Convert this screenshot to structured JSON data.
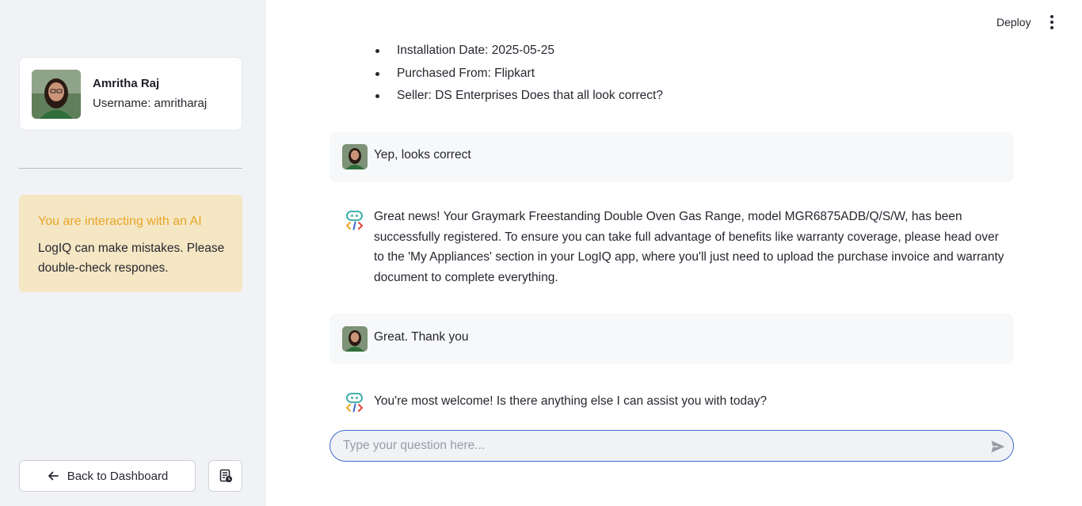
{
  "sidebar": {
    "profile": {
      "name": "Amritha Raj",
      "username": "Username: amritharaj"
    },
    "notice": {
      "title": "You are interacting with an AI",
      "body": "LogIQ can make mistakes. Please double-check respones."
    },
    "back_button_label": "Back to Dashboard"
  },
  "topbar": {
    "deploy_label": "Deploy"
  },
  "chat": {
    "bullets": [
      "Installation Date: 2025-05-25",
      "Purchased From: Flipkart",
      "Seller: DS Enterprises Does that all look correct?"
    ],
    "messages": [
      {
        "role": "user",
        "text": "Yep, looks correct"
      },
      {
        "role": "assistant",
        "text": "Great news! Your Graymark Freestanding Double Oven Gas Range, model MGR6875ADB/Q/S/W, has been successfully registered. To ensure you can take full advantage of benefits like warranty coverage, please head over to the 'My Appliances' section in your LogIQ app, where you'll just need to upload the purchase invoice and warranty document to complete everything."
      },
      {
        "role": "user",
        "text": "Great. Thank you"
      },
      {
        "role": "assistant",
        "text": "You're most welcome! Is there anything else I can assist you with today?"
      }
    ],
    "input": {
      "placeholder": "Type your question here...",
      "value": ""
    }
  },
  "colors": {
    "sidebar_bg": "#f0f2f6",
    "notice_bg": "#f5e6c4",
    "notice_title": "#e8a628",
    "input_border": "#3d6bc9"
  },
  "icons": {
    "back": "arrow-left-icon",
    "doc": "document-clock-icon",
    "menu": "kebab-menu-icon",
    "send": "send-icon",
    "bot": "bot-code-icon"
  }
}
